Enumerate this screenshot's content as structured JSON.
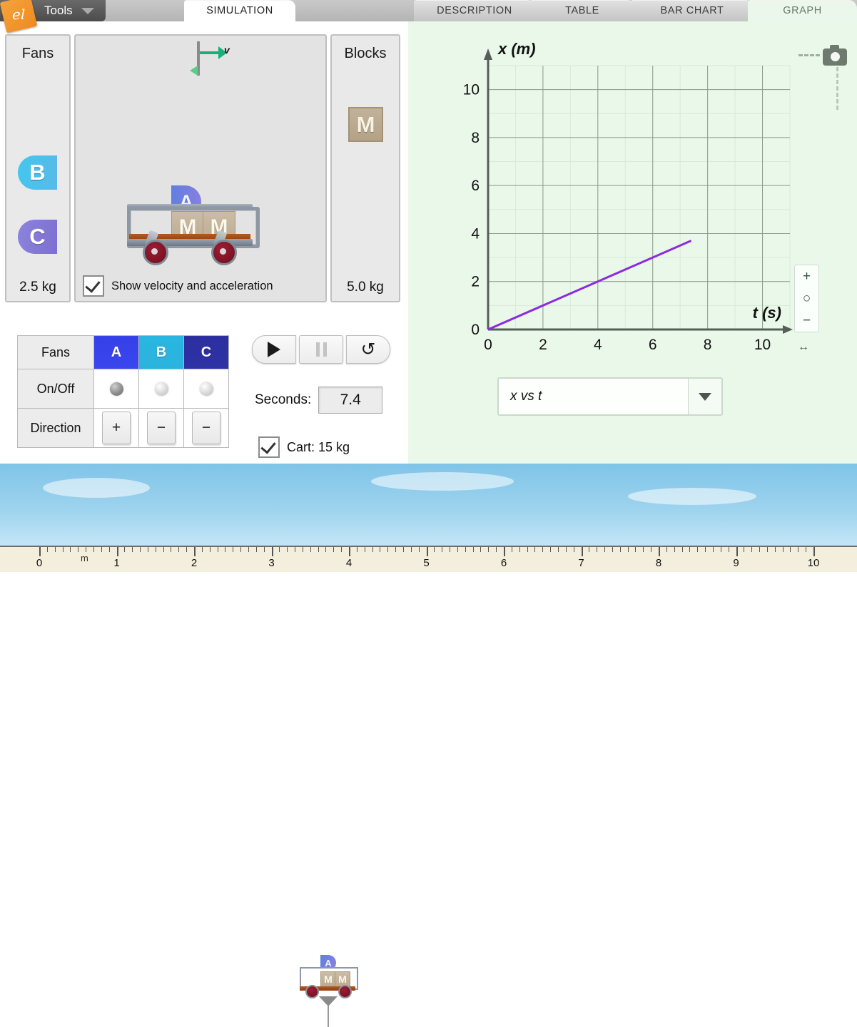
{
  "toolbar": {
    "tools_label": "Tools",
    "logo_glyph": "el"
  },
  "tabs": [
    {
      "label": "SIMULATION",
      "active": true
    },
    {
      "label": "DESCRIPTION",
      "active": false
    },
    {
      "label": "TABLE",
      "active": false
    },
    {
      "label": "BAR CHART",
      "active": false
    },
    {
      "label": "GRAPH",
      "active": false
    }
  ],
  "fans_panel": {
    "title": "Fans",
    "mass": "2.5 kg",
    "items": [
      {
        "label": "B",
        "color": "#43c7ee"
      },
      {
        "label": "C",
        "color": "#8b84dd"
      }
    ]
  },
  "blocks_panel": {
    "title": "Blocks",
    "mass": "5.0 kg",
    "block_label": "M"
  },
  "stage": {
    "velocity_label": "v",
    "cart_fan_label": "A",
    "cart_block_1": "M",
    "cart_block_2": "M",
    "show_velocity_label": "Show velocity and acceleration",
    "show_velocity_checked": true
  },
  "fan_table": {
    "header_label": "Fans",
    "onoff_label": "On/Off",
    "direction_label": "Direction",
    "columns": [
      {
        "name": "A",
        "color": "#3540e8",
        "on": true,
        "direction": "+"
      },
      {
        "name": "B",
        "color": "#29b6e0",
        "on": false,
        "direction": "−"
      },
      {
        "name": "C",
        "color": "#2b2f9e",
        "on": false,
        "direction": "−"
      }
    ]
  },
  "transport": {
    "play_name": "play",
    "pause_name": "pause",
    "reset_name": "reset",
    "reset_glyph": "↺"
  },
  "readouts": {
    "seconds_label": "Seconds:",
    "seconds_value": "7.4",
    "cart_label": "Cart: 15 kg",
    "cart_checked": true
  },
  "graph_panel": {
    "dropdown_value": "x vs t",
    "camera_icon": "camera-icon",
    "zoom_in": "+",
    "zoom_reset": "○",
    "zoom_out": "−",
    "hscale_icon": "↔"
  },
  "chart_data": {
    "type": "line",
    "title": "",
    "xlabel": "t (s)",
    "ylabel": "x (m)",
    "xlim": [
      0,
      11
    ],
    "ylim": [
      0,
      11
    ],
    "xticks": [
      0,
      2,
      4,
      6,
      8,
      10
    ],
    "yticks": [
      0,
      2,
      4,
      6,
      8,
      10
    ],
    "minor_tick_step": 1,
    "grid": true,
    "legend": false,
    "series": [
      {
        "name": "x vs t",
        "color": "#8a2be2",
        "x": [
          0,
          7.4
        ],
        "y": [
          0,
          3.7
        ]
      }
    ],
    "slope": 0.5,
    "slope_units": "m/s"
  },
  "scene": {
    "ruler_unit": "m",
    "ruler_labels": [
      "0",
      "1",
      "2",
      "3",
      "4",
      "5",
      "6",
      "7",
      "8",
      "9",
      "10"
    ],
    "cart_fan_label": "A",
    "cart_block_1": "M",
    "cart_block_2": "M",
    "cart_position_m": 3.7
  }
}
